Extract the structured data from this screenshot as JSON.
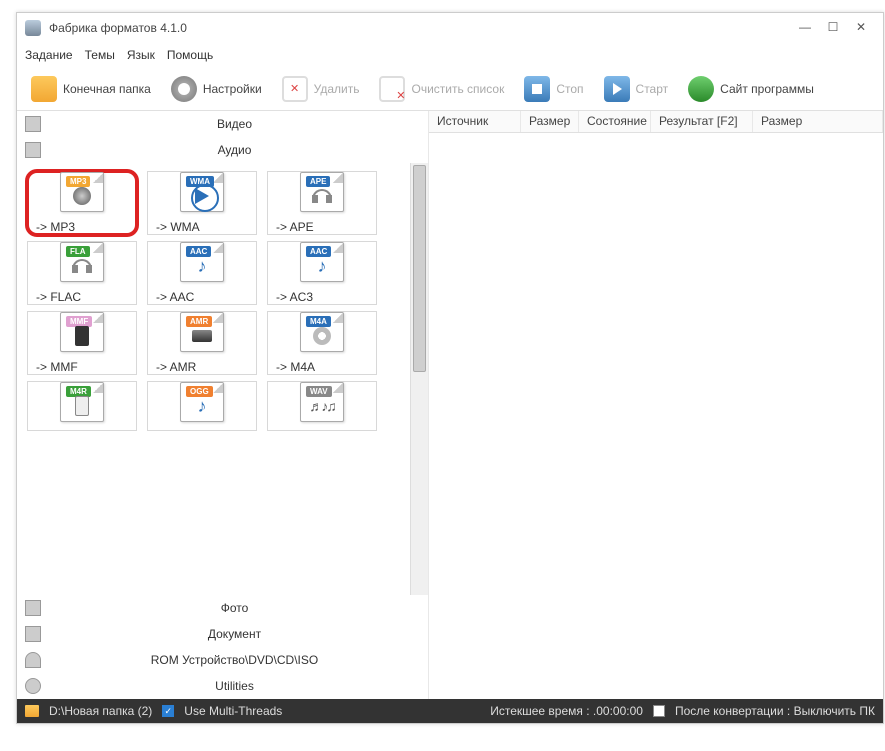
{
  "window": {
    "title": "Фабрика форматов 4.1.0"
  },
  "menu": {
    "task": "Задание",
    "theme": "Темы",
    "lang": "Язык",
    "help": "Помощь"
  },
  "toolbar": {
    "out_folder": "Конечная папка",
    "settings": "Настройки",
    "delete": "Удалить",
    "clear": "Очистить список",
    "stop": "Стоп",
    "start": "Старт",
    "site": "Сайт программы"
  },
  "categories": {
    "video": "Видео",
    "audio": "Аудио",
    "photo": "Фото",
    "document": "Документ",
    "rom": "ROM Устройство\\DVD\\CD\\ISO",
    "utilities": "Utilities"
  },
  "formats": [
    {
      "tag": "MP3",
      "label": "-> MP3",
      "tagcls": "t-mp3",
      "glyph": "g-speaker",
      "highlight": true
    },
    {
      "tag": "WMA",
      "label": "-> WMA",
      "tagcls": "t-wma",
      "glyph": "g-play"
    },
    {
      "tag": "APE",
      "label": "-> APE",
      "tagcls": "t-ape",
      "glyph": "g-hp"
    },
    {
      "tag": "FLA",
      "label": "-> FLAC",
      "tagcls": "t-fla",
      "glyph": "g-hp"
    },
    {
      "tag": "AAC",
      "label": "-> AAC",
      "tagcls": "t-aac",
      "glyph": "g-note"
    },
    {
      "tag": "AAC",
      "label": "-> AC3",
      "tagcls": "t-aac",
      "glyph": "g-note"
    },
    {
      "tag": "MMF",
      "label": "-> MMF",
      "tagcls": "t-mmf",
      "glyph": "g-device"
    },
    {
      "tag": "AMR",
      "label": "-> AMR",
      "tagcls": "t-amr",
      "glyph": "g-recorder"
    },
    {
      "tag": "M4A",
      "label": "-> M4A",
      "tagcls": "t-m4a",
      "glyph": "g-disc"
    },
    {
      "tag": "M4R",
      "label": "",
      "tagcls": "t-m4r",
      "glyph": "g-ipod"
    },
    {
      "tag": "OGG",
      "label": "",
      "tagcls": "t-ogg",
      "glyph": "g-note"
    },
    {
      "tag": "WAV",
      "label": "",
      "tagcls": "t-wav",
      "glyph": "g-waves"
    }
  ],
  "columns": {
    "source": "Источник",
    "size": "Размер",
    "state": "Состояние",
    "result": "Результат [F2]",
    "size2": "Размер"
  },
  "status": {
    "path": "D:\\Новая папка (2)",
    "multi": "Use Multi-Threads",
    "elapsed": "Истекшее время : .00:00:00",
    "shutdown": "После конвертации : Выключить ПК"
  }
}
